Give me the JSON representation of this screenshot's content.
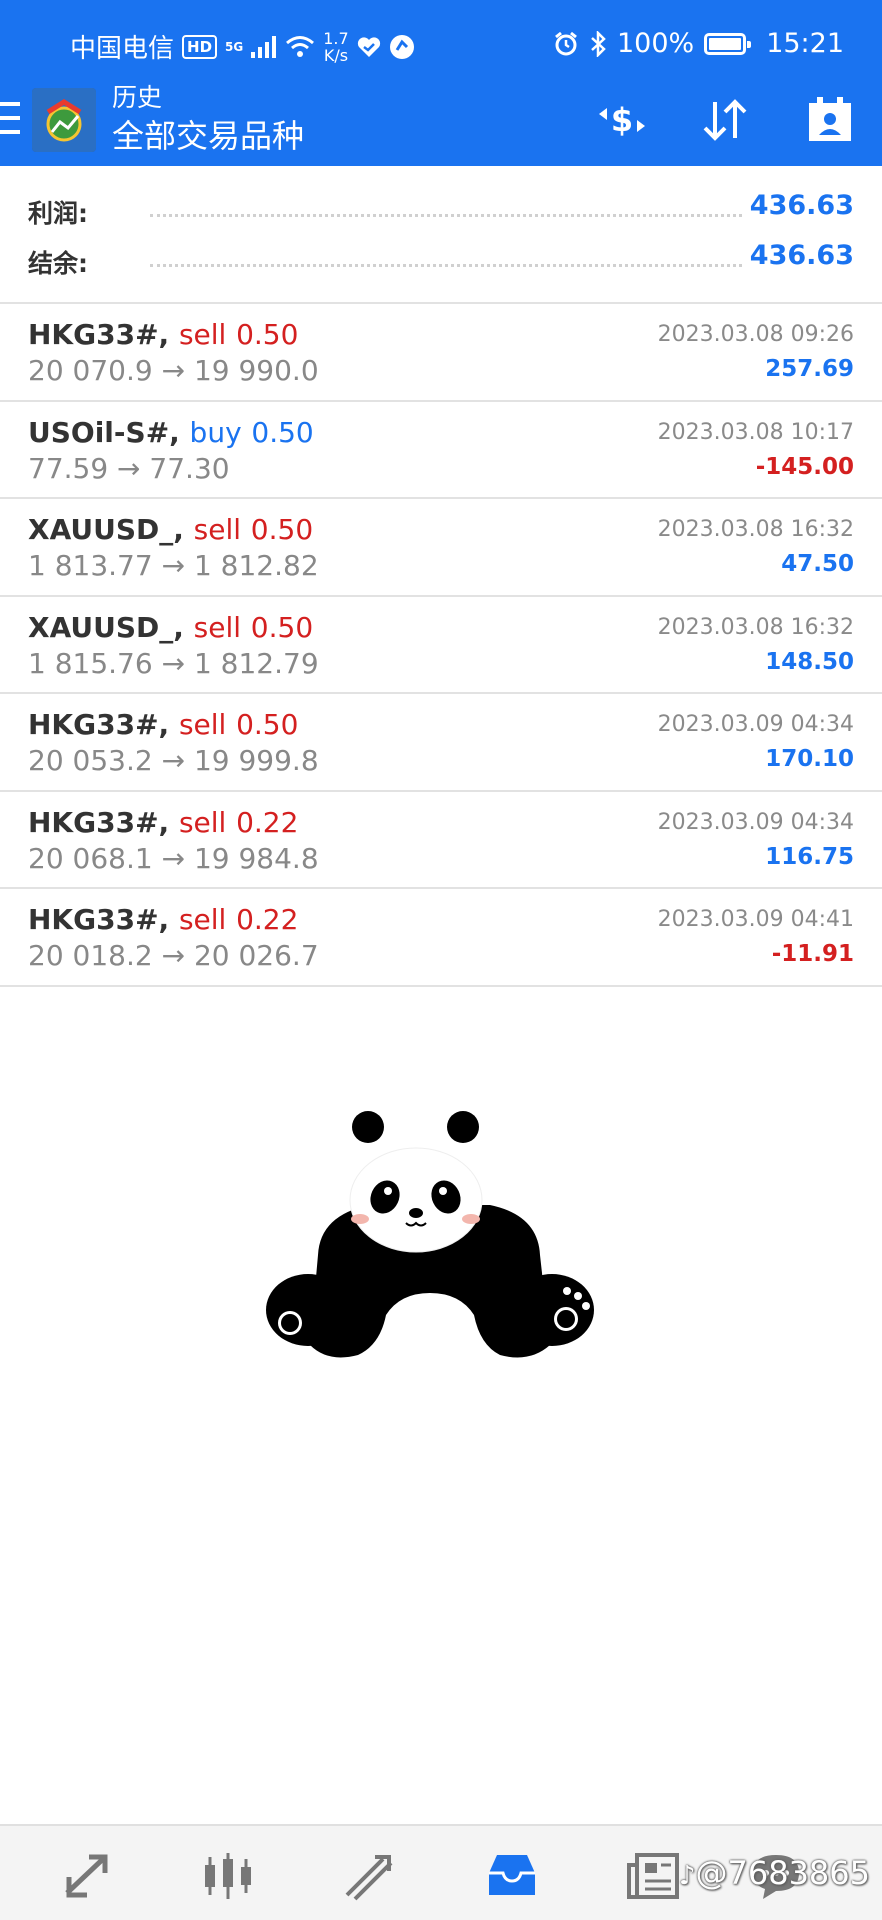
{
  "status_bar": {
    "carrier": "中国电信",
    "hd_badge": "HD",
    "network_gen": "5G",
    "net_speed_value": "1.7",
    "net_speed_unit": "K/s",
    "battery": "100%",
    "time": "15:21",
    "icons": [
      "signal-icon",
      "wifi-icon",
      "heart-icon",
      "app-notification-icon",
      "alarm-icon",
      "bluetooth-icon",
      "battery-icon"
    ]
  },
  "header": {
    "subtitle": "历史",
    "title": "全部交易品种",
    "actions": [
      "currency-switch-icon",
      "sort-icon",
      "calendar-icon"
    ]
  },
  "summary": {
    "profit_label": "利润:",
    "profit_value": "436.63",
    "balance_label": "结余:",
    "balance_value": "436.63"
  },
  "trades": [
    {
      "symbol": "HKG33#,",
      "side": "sell",
      "volume": "0.50",
      "prices": "20 070.9 → 19 990.0",
      "time": "2023.03.08 09:26",
      "profit": "257.69"
    },
    {
      "symbol": "USOil-S#,",
      "side": "buy",
      "volume": "0.50",
      "prices": "77.59 → 77.30",
      "time": "2023.03.08 10:17",
      "profit": "-145.00"
    },
    {
      "symbol": "XAUUSD_,",
      "side": "sell",
      "volume": "0.50",
      "prices": "1 813.77 → 1 812.82",
      "time": "2023.03.08 16:32",
      "profit": "47.50"
    },
    {
      "symbol": "XAUUSD_,",
      "side": "sell",
      "volume": "0.50",
      "prices": "1 815.76 → 1 812.79",
      "time": "2023.03.08 16:32",
      "profit": "148.50"
    },
    {
      "symbol": "HKG33#,",
      "side": "sell",
      "volume": "0.50",
      "prices": "20 053.2 → 19 999.8",
      "time": "2023.03.09 04:34",
      "profit": "170.10"
    },
    {
      "symbol": "HKG33#,",
      "side": "sell",
      "volume": "0.22",
      "prices": "20 068.1 → 19 984.8",
      "time": "2023.03.09 04:34",
      "profit": "116.75"
    },
    {
      "symbol": "HKG33#,",
      "side": "sell",
      "volume": "0.22",
      "prices": "20 018.2 → 20 026.7",
      "time": "2023.03.09 04:41",
      "profit": "-11.91"
    }
  ],
  "bottom_nav": {
    "items": [
      "quotes-icon",
      "chart-icon",
      "trade-icon",
      "history-icon",
      "news-icon",
      "chat-icon"
    ],
    "active": "history-icon",
    "watermark": "@7683865"
  },
  "colors": {
    "accent": "#1a73f0",
    "sell": "#d42020",
    "buy": "#1a73f0",
    "negative": "#d42020"
  }
}
